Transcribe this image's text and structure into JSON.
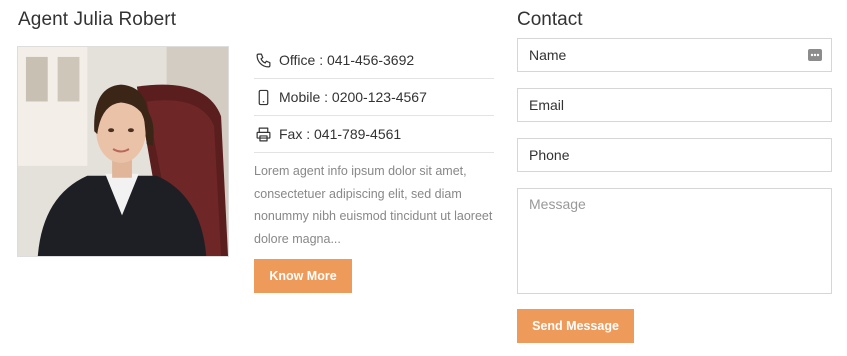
{
  "agent": {
    "title": "Agent Julia Robert",
    "office": "Office : 041-456-3692",
    "mobile": "Mobile : 0200-123-4567",
    "fax": "Fax : 041-789-4561",
    "description": "Lorem agent info ipsum dolor sit amet, consectetuer adipiscing elit, sed diam nonummy nibh euismod tincidunt ut laoreet dolore magna...",
    "know_more_label": "Know More"
  },
  "contact": {
    "title": "Contact",
    "name_placeholder": "Name",
    "email_placeholder": "Email",
    "phone_placeholder": "Phone",
    "message_placeholder": "Message",
    "send_label": "Send Message"
  },
  "colors": {
    "accent": "#ee9a5a",
    "muted_text": "#888888",
    "border": "#d6d6d6"
  },
  "icons": {
    "office": "phone-icon",
    "mobile": "mobile-icon",
    "fax": "printer-icon",
    "autofill": "autofill-key-icon"
  }
}
